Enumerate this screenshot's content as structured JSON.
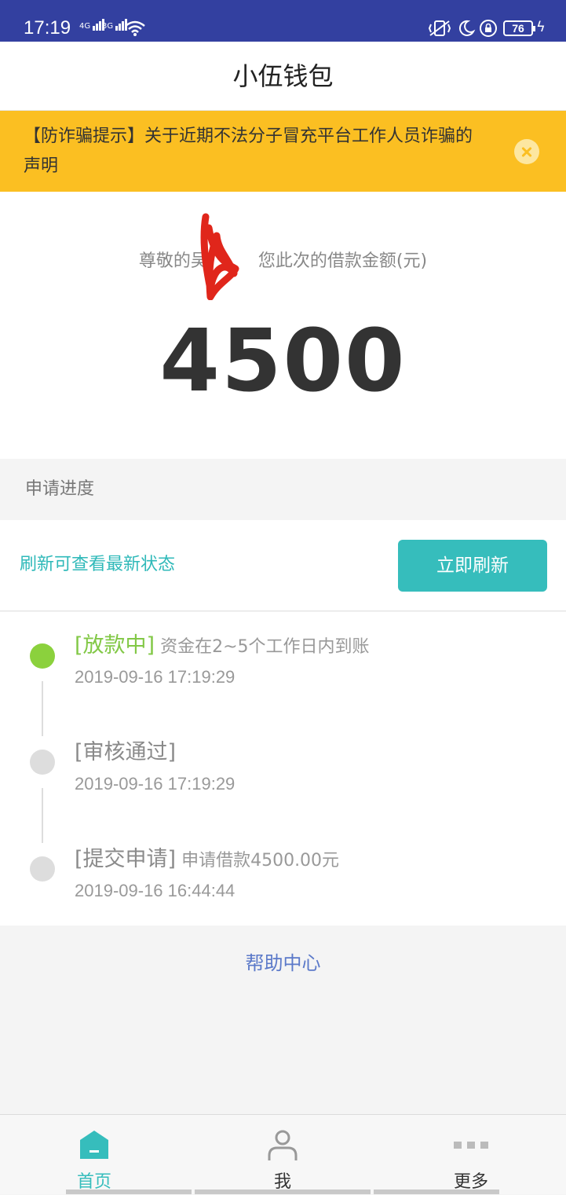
{
  "status_bar": {
    "time": "17:19",
    "net1": "4G",
    "net2": "3G",
    "battery": "76"
  },
  "header": {
    "title": "小伍钱包"
  },
  "notice": {
    "text": "【防诈骗提示】关于近期不法分子冒充平台工作人员诈骗的声明",
    "bg_color": "#fbbf22"
  },
  "loan": {
    "greeting_prefix": "尊敬的吴",
    "greeting_suffix": "您此次的借款金额(元)",
    "amount": "4500"
  },
  "progress": {
    "section_label": "申请进度",
    "refresh_hint": "刷新可查看最新状态",
    "refresh_button": "立即刷新",
    "steps": [
      {
        "tag": "[放款中]",
        "detail": "资金在2~5个工作日内到账",
        "time": "2019-09-16 17:19:29",
        "active": true
      },
      {
        "tag": "[审核通过]",
        "detail": "",
        "time": "2019-09-16 17:19:29",
        "active": false
      },
      {
        "tag": "[提交申请]",
        "detail": "申请借款4500.00元",
        "time": "2019-09-16 16:44:44",
        "active": false
      }
    ]
  },
  "help": {
    "label": "帮助中心"
  },
  "tabs": [
    {
      "label": "首页",
      "icon": "home-icon",
      "active": true
    },
    {
      "label": "我",
      "icon": "user-icon",
      "active": false
    },
    {
      "label": "更多",
      "icon": "more-icon",
      "active": false
    }
  ],
  "colors": {
    "accent": "#36bdbc",
    "status_bar": "#3340a0",
    "active_step": "#8bd13d",
    "link": "#5b79c9"
  }
}
